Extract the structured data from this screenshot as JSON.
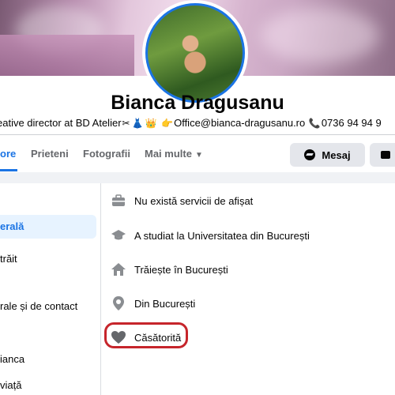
{
  "profile": {
    "name": "Bianca Dragusanu",
    "bio_text": "eative director at BD Atelier",
    "bio_emojis": [
      "✂",
      "👗",
      "👑"
    ],
    "bio_pointer": "👉",
    "bio_email": "Office@bianca-dragusanu.ro",
    "bio_phone_icon": "📞",
    "bio_phone": "0736 94 94 9"
  },
  "tabs": [
    {
      "label": "ore"
    },
    {
      "label": "Prieteni"
    },
    {
      "label": "Fotografii"
    },
    {
      "label": "Mai multe"
    }
  ],
  "actions": {
    "message_label": "Mesaj"
  },
  "sidebar": {
    "items": [
      {
        "label": "erală"
      },
      {
        "label": "trăit"
      },
      {
        "label": "rale și de contact"
      },
      {
        "label": "ianca"
      },
      {
        "label": "viață"
      }
    ]
  },
  "about": {
    "rows": [
      {
        "icon": "briefcase-icon",
        "text": "Nu există servicii de afișat"
      },
      {
        "icon": "graduation-cap-icon",
        "text": "A studiat la Universitatea din București"
      },
      {
        "icon": "home-icon",
        "text": "Trăiește în București"
      },
      {
        "icon": "location-pin-icon",
        "text": "Din București"
      },
      {
        "icon": "heart-icon",
        "text": "Căsătorită"
      }
    ]
  },
  "colors": {
    "accent": "#1b74e4",
    "highlight_annotation": "#c6252b"
  }
}
